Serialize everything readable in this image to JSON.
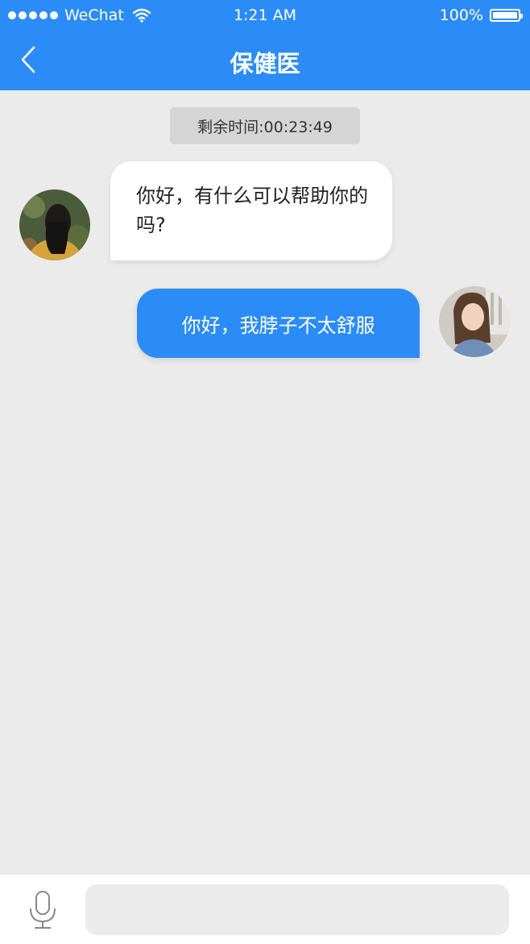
{
  "status_bar": {
    "carrier": "WeChat",
    "time": "1:21 AM",
    "battery": "100%"
  },
  "header": {
    "title": "保健医",
    "back_icon": "chevron-left-icon"
  },
  "timer": {
    "text": "剩余时间:00:23:49"
  },
  "messages": [
    {
      "sender": "doctor",
      "text": "你好，有什么可以帮助你的吗?"
    },
    {
      "sender": "user",
      "text": "你好，我脖子不太舒服"
    }
  ],
  "input_bar": {
    "mic_icon": "microphone-icon",
    "placeholder": ""
  },
  "colors": {
    "brand": "#2b8cf7",
    "background": "#ebebeb"
  }
}
